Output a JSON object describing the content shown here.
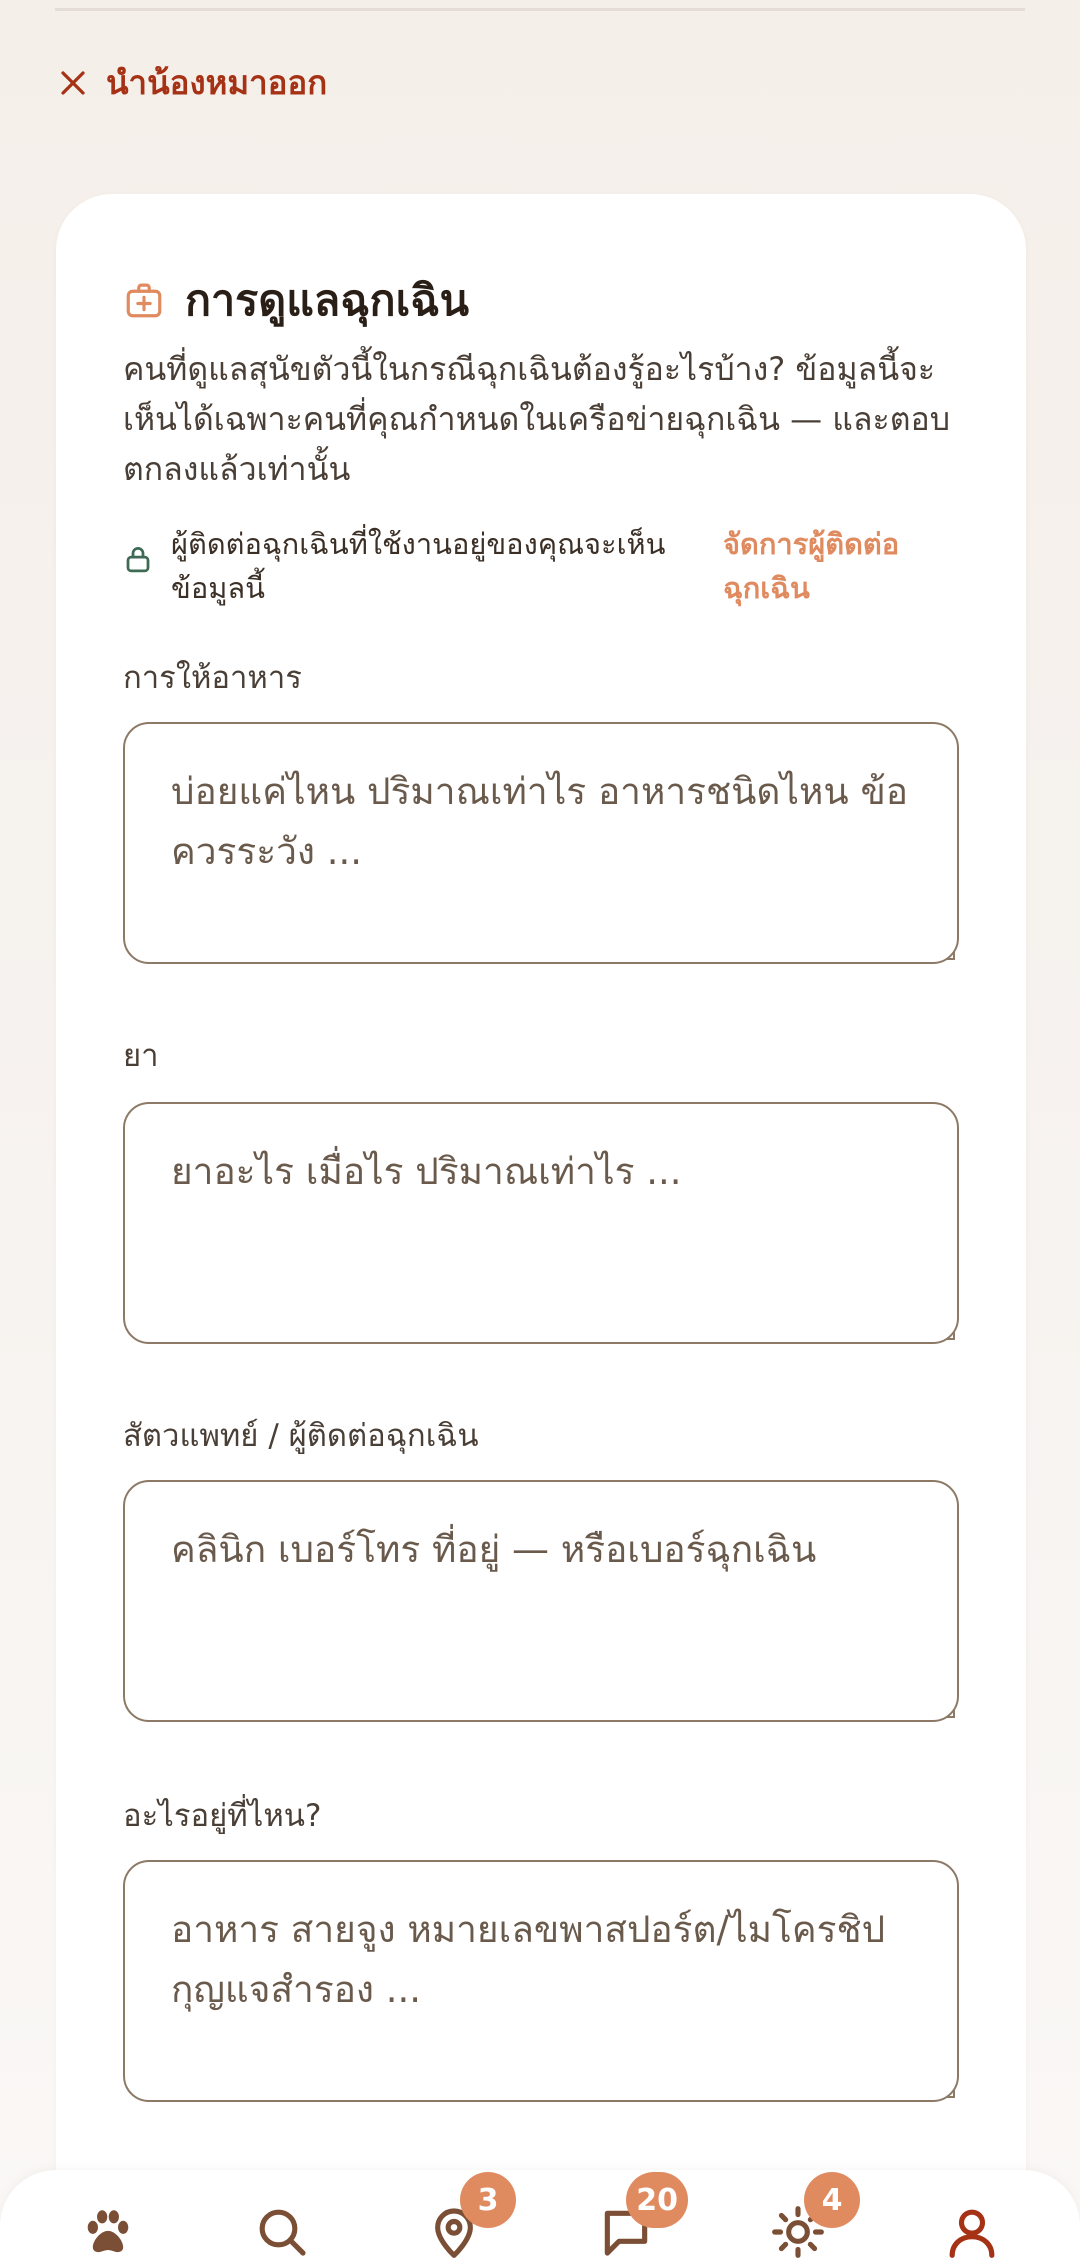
{
  "header": {
    "remove_label": "นำน้องหมาออก",
    "remove_icon": "close-icon"
  },
  "section": {
    "title": "การดูแลฉุกเฉิน",
    "icon": "first-aid-kit-icon",
    "intro": "คนที่ดูแลสุนัขตัวนี้ในกรณีฉุกเฉินต้องรู้อะไรบ้าง? ข้อมูลนี้จะเห็นได้เฉพาะคนที่คุณกำหนดในเครือข่ายฉุกเฉิน — และตอบตกลงแล้วเท่านั้น",
    "notice_text": "ผู้ติดต่อฉุกเฉินที่ใช้งานอยู่ของคุณจะเห็นข้อมูลนี้",
    "notice_icon": "lock-icon",
    "manage_link": "จัดการผู้ติดต่อฉุกเฉิน"
  },
  "fields": [
    {
      "label": "การให้อาหาร",
      "placeholder": "บ่อยแค่ไหน ปริมาณเท่าไร อาหารชนิดไหน ข้อควรระวัง ..."
    },
    {
      "label": "ยา",
      "placeholder": "ยาอะไร เมื่อไร ปริมาณเท่าไร ..."
    },
    {
      "label": "สัตวแพทย์ / ผู้ติดต่อฉุกเฉิน",
      "placeholder": "คลินิก เบอร์โทร ที่อยู่ — หรือเบอร์ฉุกเฉิน"
    },
    {
      "label": "อะไรอยู่ที่ไหน?",
      "placeholder": "อาหาร สายจูง หมายเลขพาสปอร์ต/ไมโครชิป กุญแจสำรอง ..."
    }
  ],
  "nav": {
    "items": [
      {
        "icon": "paw-icon",
        "badge": null
      },
      {
        "icon": "search-icon",
        "badge": null
      },
      {
        "icon": "map-pin-icon",
        "badge": "3"
      },
      {
        "icon": "chat-icon",
        "badge": "20"
      },
      {
        "icon": "sun-icon",
        "badge": "4"
      },
      {
        "icon": "profile-icon",
        "badge": null
      }
    ]
  },
  "colors": {
    "accent": "#e08a5f",
    "danger": "#a63216",
    "text": "#2a1f17",
    "border": "#8d7a66",
    "background": "#f6f1ed"
  }
}
